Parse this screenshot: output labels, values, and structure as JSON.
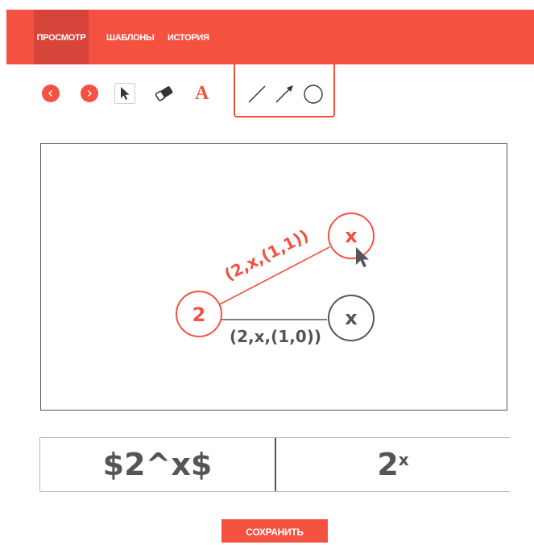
{
  "nav": {
    "tabs": [
      {
        "label": "ПРОСМОТР",
        "active": true
      },
      {
        "label": "ШАБЛОНЫ",
        "active": false
      },
      {
        "label": "ИСТОРИЯ",
        "active": false
      }
    ]
  },
  "toolbar": {
    "text_tool_glyph": "A",
    "icons": [
      "chevron-left-icon",
      "chevron-right-icon",
      "cursor-icon",
      "eraser-icon",
      "text-icon",
      "line-icon",
      "arrow-icon",
      "circle-icon"
    ]
  },
  "graph": {
    "nodes": [
      {
        "id": "n-root",
        "label": "2",
        "color": "#f55141"
      },
      {
        "id": "n-top",
        "label": "x",
        "color": "#f55141"
      },
      {
        "id": "n-bottom",
        "label": "x",
        "color": "#555555"
      }
    ],
    "edges": [
      {
        "label": "(2,x,(1,1))",
        "color": "#f55141"
      },
      {
        "label": "(2,x,(1,0))",
        "color": "#555555"
      }
    ]
  },
  "output": {
    "latex_source": "$2^x$",
    "render_base": "2",
    "render_exponent": "x"
  },
  "save_button": {
    "label": "СОХРАНИТЬ"
  },
  "colors": {
    "accent": "#f55141",
    "accent_dark": "#d6443a",
    "ink": "#555555"
  }
}
